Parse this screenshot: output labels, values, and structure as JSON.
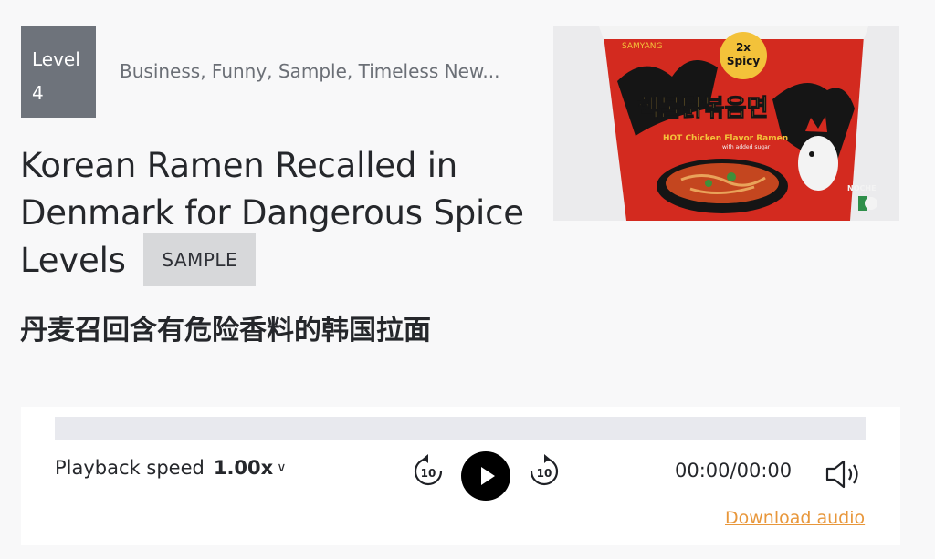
{
  "level": {
    "label": "Level",
    "number": "4"
  },
  "tags": "Business, Funny, Sample, Timeless New...",
  "article": {
    "title": "Korean Ramen Recalled in Denmark for Dangerous Spice Levels",
    "badge": "SAMPLE",
    "subtitle": "丹麦召回含有危险香料的韩国拉面"
  },
  "image": {
    "brand": "SAMYANG",
    "spicy_label_1": "2x",
    "spicy_label_2": "Spicy",
    "korean_name": "핵불닭볶음면",
    "product_name": "HOT Chicken Flavor Ramen",
    "product_note": "with added sugar",
    "side_text": "NOCHE"
  },
  "player": {
    "speed_label": "Playback speed",
    "speed_value": "1.00x",
    "rewind_seconds": "10",
    "forward_seconds": "10",
    "time": "00:00/00:00",
    "download_label": "Download audio",
    "progress": 0
  },
  "colors": {
    "badge_bg": "#6e737b",
    "accent": "#e8973b",
    "sample_bg": "#d7d8da"
  }
}
